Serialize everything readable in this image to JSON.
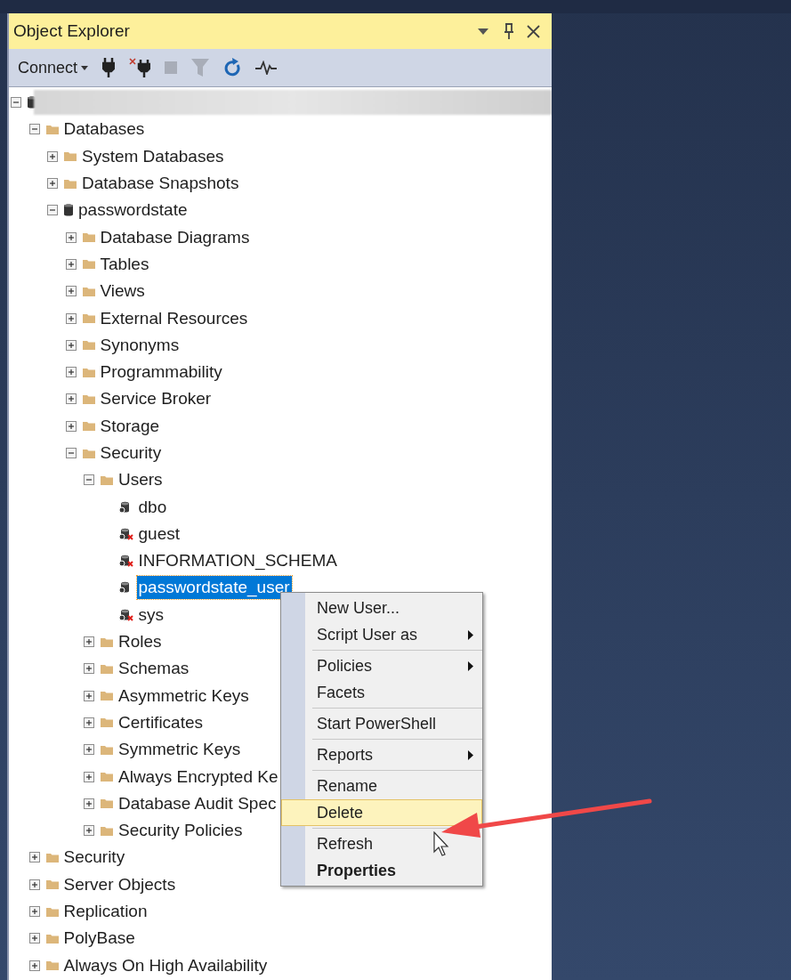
{
  "panel": {
    "title": "Object Explorer",
    "toolbar": {
      "connect": "Connect"
    }
  },
  "tree": {
    "expanded": true,
    "kind": "server",
    "children": [
      {
        "label": "Databases",
        "kind": "folder",
        "expanded": true,
        "selected": false,
        "children": [
          {
            "label": "System Databases",
            "kind": "folder",
            "expanded": false,
            "selected": false
          },
          {
            "label": "Database Snapshots",
            "kind": "folder",
            "expanded": false,
            "selected": false
          },
          {
            "label": "passwordstate",
            "kind": "database",
            "expanded": true,
            "selected": false,
            "children": [
              {
                "label": "Database Diagrams",
                "kind": "folder",
                "expanded": false,
                "selected": false
              },
              {
                "label": "Tables",
                "kind": "folder",
                "expanded": false,
                "selected": false
              },
              {
                "label": "Views",
                "kind": "folder",
                "expanded": false,
                "selected": false
              },
              {
                "label": "External Resources",
                "kind": "folder",
                "expanded": false,
                "selected": false
              },
              {
                "label": "Synonyms",
                "kind": "folder",
                "expanded": false,
                "selected": false
              },
              {
                "label": "Programmability",
                "kind": "folder",
                "expanded": false,
                "selected": false
              },
              {
                "label": "Service Broker",
                "kind": "folder",
                "expanded": false,
                "selected": false
              },
              {
                "label": "Storage",
                "kind": "folder",
                "expanded": false,
                "selected": false
              },
              {
                "label": "Security",
                "kind": "folder",
                "expanded": true,
                "selected": false,
                "children": [
                  {
                    "label": "Users",
                    "kind": "folder",
                    "expanded": true,
                    "selected": false,
                    "children": [
                      {
                        "label": "dbo",
                        "kind": "user",
                        "selected": false
                      },
                      {
                        "label": "guest",
                        "kind": "user-denied",
                        "selected": false
                      },
                      {
                        "label": "INFORMATION_SCHEMA",
                        "kind": "user-denied",
                        "selected": false
                      },
                      {
                        "label": "passwordstate_user",
                        "kind": "user",
                        "selected": true
                      },
                      {
                        "label": "sys",
                        "kind": "user-denied",
                        "selected": false
                      }
                    ]
                  },
                  {
                    "label": "Roles",
                    "kind": "folder",
                    "expanded": false,
                    "selected": false
                  },
                  {
                    "label": "Schemas",
                    "kind": "folder",
                    "expanded": false,
                    "selected": false
                  },
                  {
                    "label": "Asymmetric Keys",
                    "kind": "folder",
                    "expanded": false,
                    "selected": false
                  },
                  {
                    "label": "Certificates",
                    "kind": "folder",
                    "expanded": false,
                    "selected": false
                  },
                  {
                    "label": "Symmetric Keys",
                    "kind": "folder",
                    "expanded": false,
                    "selected": false
                  },
                  {
                    "label": "Always Encrypted Ke",
                    "kind": "folder",
                    "expanded": false,
                    "selected": false
                  },
                  {
                    "label": "Database Audit Spec",
                    "kind": "folder",
                    "expanded": false,
                    "selected": false
                  },
                  {
                    "label": "Security Policies",
                    "kind": "folder",
                    "expanded": false,
                    "selected": false
                  }
                ]
              }
            ]
          }
        ]
      },
      {
        "label": "Security",
        "kind": "folder",
        "expanded": false,
        "selected": false
      },
      {
        "label": "Server Objects",
        "kind": "folder",
        "expanded": false,
        "selected": false
      },
      {
        "label": "Replication",
        "kind": "folder",
        "expanded": false,
        "selected": false
      },
      {
        "label": "PolyBase",
        "kind": "folder",
        "expanded": false,
        "selected": false
      },
      {
        "label": "Always On High Availability",
        "kind": "folder",
        "expanded": false,
        "selected": false
      }
    ]
  },
  "context_menu": {
    "groups": [
      [
        {
          "label": "New User...",
          "submenu": false,
          "selected": false,
          "bold": false
        },
        {
          "label": "Script User as",
          "submenu": true,
          "selected": false,
          "bold": false
        }
      ],
      [
        {
          "label": "Policies",
          "submenu": true,
          "selected": false,
          "bold": false
        },
        {
          "label": "Facets",
          "submenu": false,
          "selected": false,
          "bold": false
        }
      ],
      [
        {
          "label": "Start PowerShell",
          "submenu": false,
          "selected": false,
          "bold": false
        }
      ],
      [
        {
          "label": "Reports",
          "submenu": true,
          "selected": false,
          "bold": false
        }
      ],
      [
        {
          "label": "Rename",
          "submenu": false,
          "selected": false,
          "bold": false
        },
        {
          "label": "Delete",
          "submenu": false,
          "selected": true,
          "bold": false
        }
      ],
      [
        {
          "label": "Refresh",
          "submenu": false,
          "selected": false,
          "bold": false
        },
        {
          "label": "Properties",
          "submenu": false,
          "selected": false,
          "bold": true
        }
      ]
    ]
  }
}
